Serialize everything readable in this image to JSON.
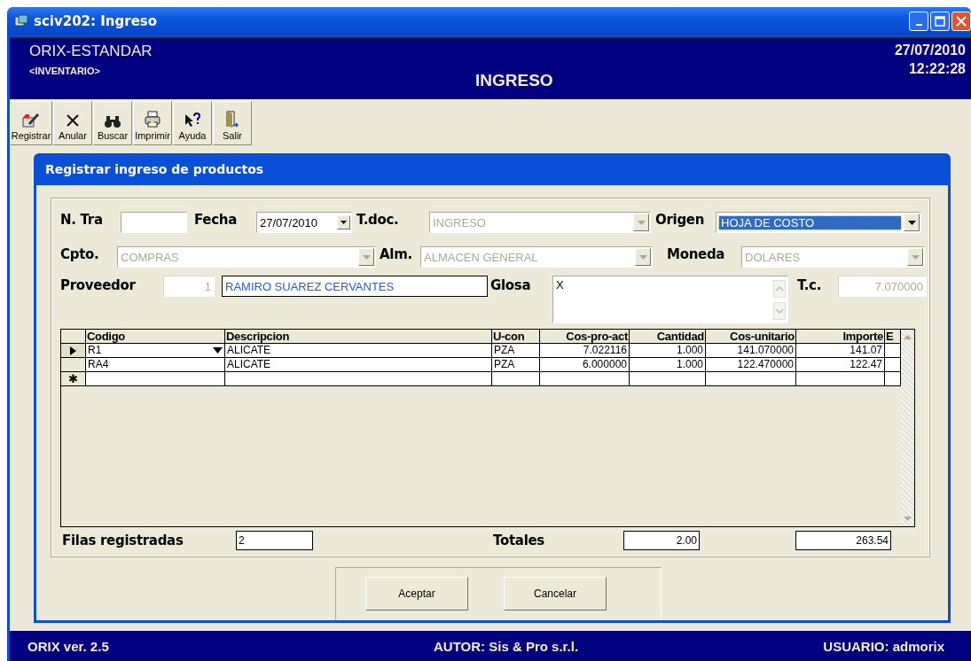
{
  "window": {
    "title": "sciv202: Ingreso"
  },
  "header": {
    "company": "ORIX-ESTANDAR",
    "module": "<INVENTARIO>",
    "title": "INGRESO",
    "date": "27/07/2010",
    "time": "12:22:28"
  },
  "toolbar": [
    {
      "label": "Registrar",
      "kind": "register"
    },
    {
      "label": "Anular",
      "kind": "cancel"
    },
    {
      "label": "Buscar",
      "kind": "search"
    },
    {
      "label": "Imprimir",
      "kind": "print"
    },
    {
      "label": "Ayuda",
      "kind": "help"
    },
    {
      "label": "Salir",
      "kind": "exit"
    }
  ],
  "dialog": {
    "title": "Registrar ingreso de productos",
    "field_rows": [
      [
        {
          "label": "N. Tra",
          "kind": "text",
          "disabled": false,
          "focused": false
        },
        {
          "label": "Fecha",
          "kind": "date",
          "value": "27/07/2010",
          "disabled": false,
          "focused": false
        },
        {
          "label": "T.doc.",
          "kind": "combo",
          "value": "INGRESO",
          "disabled": true,
          "focused": false
        },
        {
          "label": "Origen",
          "kind": "combo",
          "value": "HOJA DE COSTO",
          "disabled": false,
          "focused": true
        }
      ],
      [
        {
          "label": "Cpto.",
          "kind": "combo",
          "value": "COMPRAS",
          "disabled": true,
          "focused": false
        },
        {
          "label": "Alm.",
          "kind": "combo",
          "value": "ALMACEN GENERAL",
          "disabled": true,
          "focused": false
        },
        {
          "label": "Moneda",
          "kind": "combo",
          "value": "DOLARES",
          "disabled": true,
          "focused": false
        }
      ],
      [
        {
          "label": "Proveedor",
          "kind": "text",
          "value": "1",
          "disabled": true,
          "focused": false
        },
        {
          "kind": "text",
          "value": "RAMIRO SUAREZ CERVANTES",
          "disabled": false,
          "focused": false
        },
        {
          "label": "Glosa",
          "kind": "memo",
          "value": "X",
          "disabled": false,
          "focused": false
        },
        {
          "label": "T.c.",
          "kind": "text",
          "value": "7.070000",
          "disabled": true,
          "focused": false
        }
      ]
    ],
    "table": {
      "columns": [
        "Codigo",
        "Descripcion",
        "U-con",
        "Cos-pro-act",
        "Cantidad",
        "Cos-unitario",
        "Importe",
        "E"
      ],
      "rows": [
        {
          "current": true,
          "cells": [
            "R1",
            "ALICATE",
            "PZA",
            "7.022116",
            "1.000",
            "141.070000",
            "141.07",
            ""
          ]
        },
        {
          "current": false,
          "cells": [
            "RA4",
            "ALICATE",
            "PZA",
            "6.000000",
            "1.000",
            "122.470000",
            "122.47",
            ""
          ]
        }
      ],
      "new_row_marker": "✱"
    },
    "footer": {
      "rows_label": "Filas registradas",
      "rows_value": "2",
      "totals_label": "Totales",
      "total_quantity": "2.00",
      "total_amount": "263.54"
    },
    "buttons": [
      "Aceptar",
      "Cancelar"
    ]
  },
  "status_bar": [
    "ORIX ver. 2.5",
    "AUTOR: Sis & Pro s.r.l.",
    "USUARIO: admorix"
  ]
}
